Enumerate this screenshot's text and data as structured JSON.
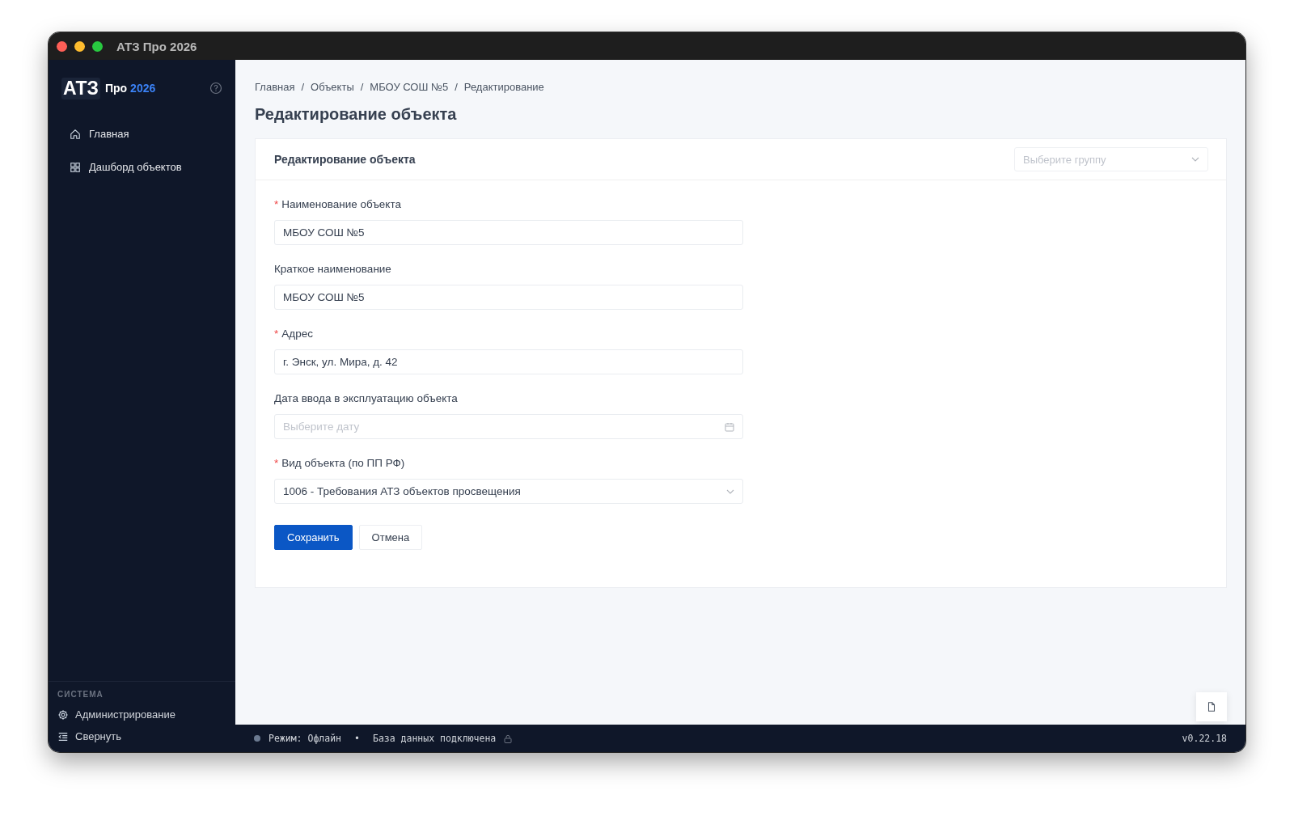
{
  "window": {
    "title": "АТЗ Про 2026"
  },
  "sidebar": {
    "logo": {
      "mark": "АТЗ",
      "product": "Про",
      "year": "2026"
    },
    "items": [
      {
        "label": "Главная"
      },
      {
        "label": "Дашборд объектов"
      }
    ],
    "section_title": "СИСТЕМА",
    "footer_items": [
      {
        "label": "Администрирование"
      },
      {
        "label": "Свернуть"
      }
    ]
  },
  "breadcrumbs": [
    {
      "label": "Главная"
    },
    {
      "separator": "/",
      "label": "Объекты"
    },
    {
      "separator": "/",
      "label": "МБОУ СОШ №5"
    },
    {
      "separator": "/",
      "label": "Редактирование"
    }
  ],
  "page_title": "Редактирование объекта",
  "card": {
    "title": "Редактирование объекта",
    "group_select": {
      "placeholder": "Выберите группу"
    },
    "fields": [
      {
        "kind": "input",
        "required_mark": "*",
        "label": "Наименование объекта",
        "value": "МБОУ СОШ №5"
      },
      {
        "kind": "input",
        "label": "Краткое наименование",
        "value": "МБОУ СОШ №5"
      },
      {
        "kind": "input",
        "required_mark": "*",
        "label": "Адрес",
        "value": "г. Энск, ул. Мира, д. 42"
      },
      {
        "kind": "date",
        "label": "Дата ввода в эксплуатацию объекта",
        "placeholder": "Выберите дату"
      },
      {
        "kind": "select",
        "required_mark": "*",
        "label": "Вид объекта (по ПП РФ)",
        "value": "1006 - Требования АТЗ объектов просвещения"
      }
    ],
    "buttons": [
      {
        "label": "Сохранить",
        "kind": "primary"
      },
      {
        "label": "Отмена",
        "kind": "default"
      }
    ]
  },
  "status_bar": {
    "mode": "Режим: Офлайн",
    "separator": "•",
    "database": "База данных подключена",
    "version": "v0.22.18"
  }
}
